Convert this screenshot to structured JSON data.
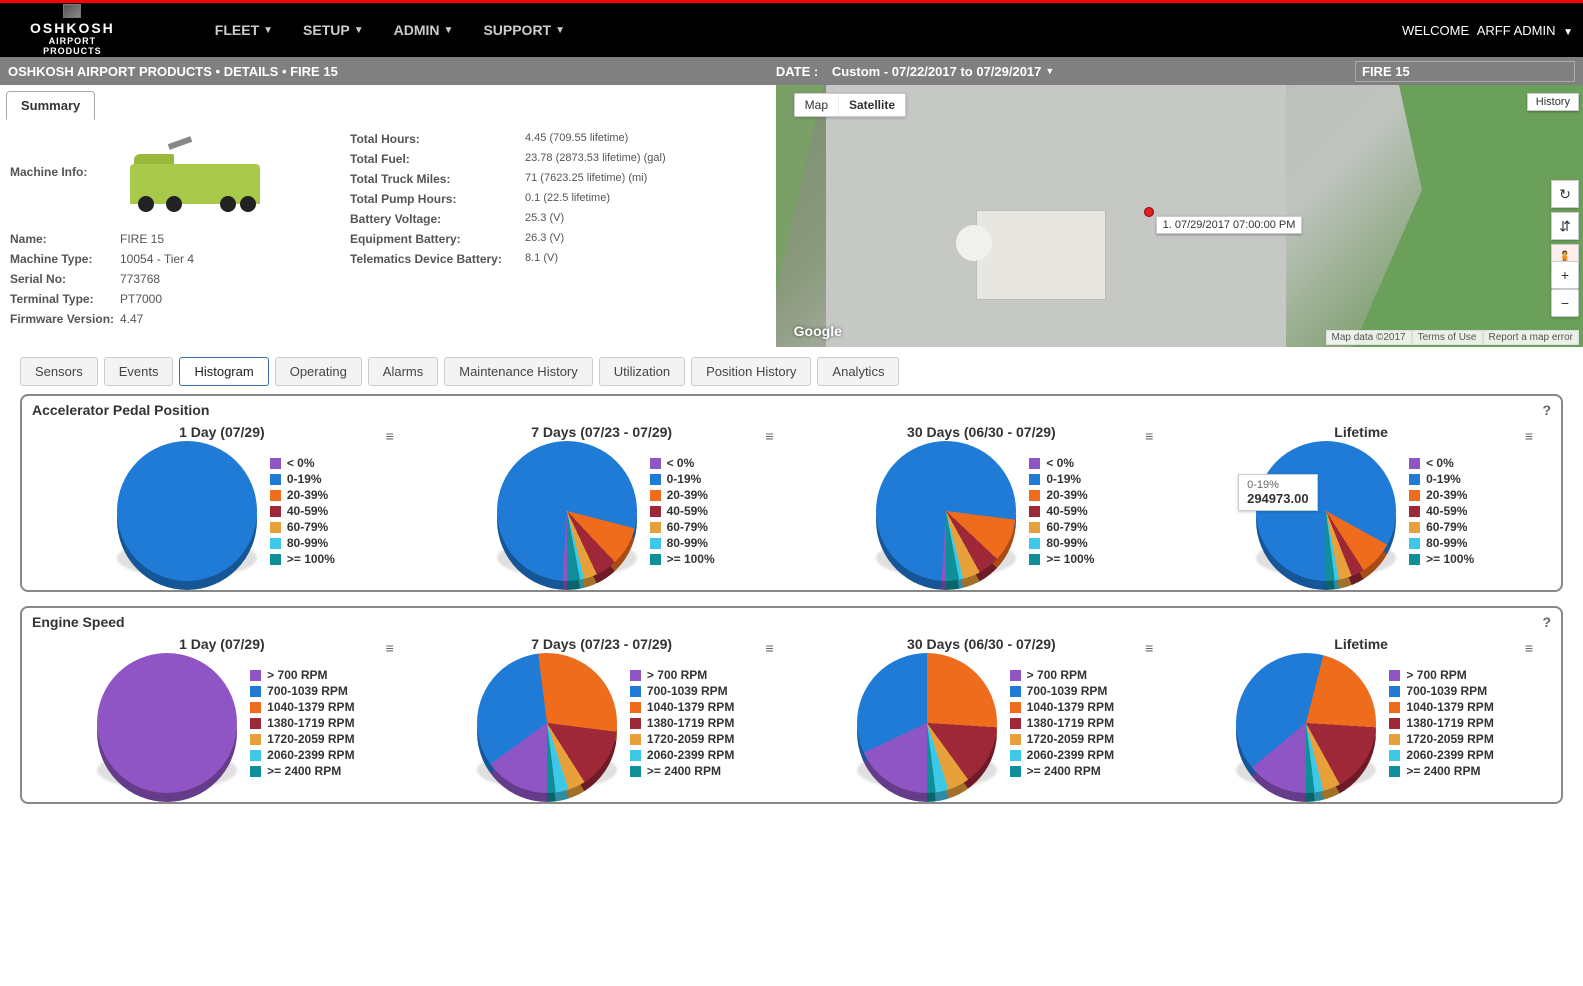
{
  "brand": {
    "name": "OSHKOSH",
    "sub1": "AIRPORT",
    "sub2": "PRODUCTS"
  },
  "nav": {
    "fleet": "FLEET",
    "setup": "SETUP",
    "admin": "ADMIN",
    "support": "SUPPORT"
  },
  "welcome": {
    "label": "WELCOME",
    "user": "ARFF ADMIN"
  },
  "breadcrumb": {
    "text": "OSHKOSH AIRPORT PRODUCTS • DETAILS • FIRE 15",
    "date_label": "DATE :",
    "date_value": "Custom - 07/22/2017 to 07/29/2017",
    "search_value": "FIRE 15"
  },
  "summary_tab": "Summary",
  "machine_info_label": "Machine Info:",
  "info_left": [
    {
      "k": "Name:",
      "v": "FIRE 15"
    },
    {
      "k": "Machine Type:",
      "v": "10054 - Tier 4"
    },
    {
      "k": "Serial No:",
      "v": "773768"
    },
    {
      "k": "Terminal Type:",
      "v": "PT7000"
    },
    {
      "k": "Firmware Version:",
      "v": "4.47"
    }
  ],
  "info_right": [
    {
      "k": "Total Hours:",
      "v": "4.45 (709.55 lifetime)"
    },
    {
      "k": "Total Fuel:",
      "v": "23.78 (2873.53 lifetime) (gal)"
    },
    {
      "k": "Total Truck Miles:",
      "v": "71 (7623.25 lifetime) (mi)"
    },
    {
      "k": "Total Pump Hours:",
      "v": "0.1 (22.5 lifetime)"
    },
    {
      "k": "Battery Voltage:",
      "v": "25.3 (V)"
    },
    {
      "k": "Equipment Battery:",
      "v": "26.3 (V)"
    },
    {
      "k": "Telematics Device Battery:",
      "v": "8.1 (V)"
    }
  ],
  "map": {
    "type_map": "Map",
    "type_sat": "Satellite",
    "history": "History",
    "tooltip": "1. 07/29/2017 07:00:00 PM",
    "google": "Google",
    "data": "Map data ©2017",
    "terms": "Terms of Use",
    "report": "Report a map error"
  },
  "tabs": [
    "Sensors",
    "Events",
    "Histogram",
    "Operating",
    "Alarms",
    "Maintenance History",
    "Utilization",
    "Position History",
    "Analytics"
  ],
  "active_tab": "Histogram",
  "panels": {
    "accel": {
      "title": "Accelerator Pedal Position",
      "legend": [
        "< 0%",
        "0-19%",
        "20-39%",
        "40-59%",
        "60-79%",
        "80-99%",
        ">= 100%"
      ]
    },
    "engine": {
      "title": "Engine Speed",
      "legend": [
        "> 700 RPM",
        "700-1039 RPM",
        "1040-1379 RPM",
        "1380-1719 RPM",
        "1720-2059 RPM",
        "2060-2399 RPM",
        ">= 2400 RPM"
      ]
    }
  },
  "chart_titles": {
    "d1": "1 Day (07/29)",
    "d7": "7 Days (07/23 - 07/29)",
    "d30": "30 Days (06/30 - 07/29)",
    "life": "Lifetime"
  },
  "lifetime_tooltip": {
    "cat": "0-19%",
    "val": "294973.00"
  },
  "chart_data": [
    {
      "type": "pie",
      "title": "Accelerator Pedal Position — 1 Day (07/29)",
      "categories": [
        "< 0%",
        "0-19%",
        "20-39%",
        "40-59%",
        "60-79%",
        "80-99%",
        ">= 100%"
      ],
      "values": [
        0,
        100,
        0,
        0,
        0,
        0,
        0
      ]
    },
    {
      "type": "pie",
      "title": "Accelerator Pedal Position — 7 Days (07/23 - 07/29)",
      "categories": [
        "< 0%",
        "0-19%",
        "20-39%",
        "40-59%",
        "60-79%",
        "80-99%",
        ">= 100%"
      ],
      "values": [
        1,
        78,
        9,
        5,
        3,
        1,
        3
      ]
    },
    {
      "type": "pie",
      "title": "Accelerator Pedal Position — 30 Days (06/30 - 07/29)",
      "categories": [
        "< 0%",
        "0-19%",
        "20-39%",
        "40-59%",
        "60-79%",
        "80-99%",
        ">= 100%"
      ],
      "values": [
        1,
        76,
        10,
        5,
        4,
        1,
        3
      ]
    },
    {
      "type": "pie",
      "title": "Accelerator Pedal Position — Lifetime",
      "categories": [
        "< 0%",
        "0-19%",
        "20-39%",
        "40-59%",
        "60-79%",
        "80-99%",
        ">= 100%"
      ],
      "values": [
        0,
        83,
        8,
        3,
        3,
        1,
        2
      ],
      "raw_values_note": "0-19% = 294973.00"
    },
    {
      "type": "pie",
      "title": "Engine Speed — 1 Day (07/29)",
      "categories": [
        "> 700 RPM",
        "700-1039 RPM",
        "1040-1379 RPM",
        "1380-1719 RPM",
        "1720-2059 RPM",
        "2060-2399 RPM",
        ">= 2400 RPM"
      ],
      "values": [
        100,
        0,
        0,
        0,
        0,
        0,
        0
      ]
    },
    {
      "type": "pie",
      "title": "Engine Speed — 7 Days (07/23 - 07/29)",
      "categories": [
        "> 700 RPM",
        "700-1039 RPM",
        "1040-1379 RPM",
        "1380-1719 RPM",
        "1720-2059 RPM",
        "2060-2399 RPM",
        ">= 2400 RPM"
      ],
      "values": [
        15,
        33,
        29,
        14,
        4,
        3,
        2
      ]
    },
    {
      "type": "pie",
      "title": "Engine Speed — 30 Days (06/30 - 07/29)",
      "categories": [
        "> 700 RPM",
        "700-1039 RPM",
        "1040-1379 RPM",
        "1380-1719 RPM",
        "1720-2059 RPM",
        "2060-2399 RPM",
        ">= 2400 RPM"
      ],
      "values": [
        18,
        32,
        26,
        14,
        5,
        3,
        2
      ]
    },
    {
      "type": "pie",
      "title": "Engine Speed — Lifetime",
      "categories": [
        "> 700 RPM",
        "700-1039 RPM",
        "1040-1379 RPM",
        "1380-1719 RPM",
        "1720-2059 RPM",
        "2060-2399 RPM",
        ">= 2400 RPM"
      ],
      "values": [
        14,
        40,
        22,
        16,
        4,
        2,
        2
      ]
    }
  ]
}
